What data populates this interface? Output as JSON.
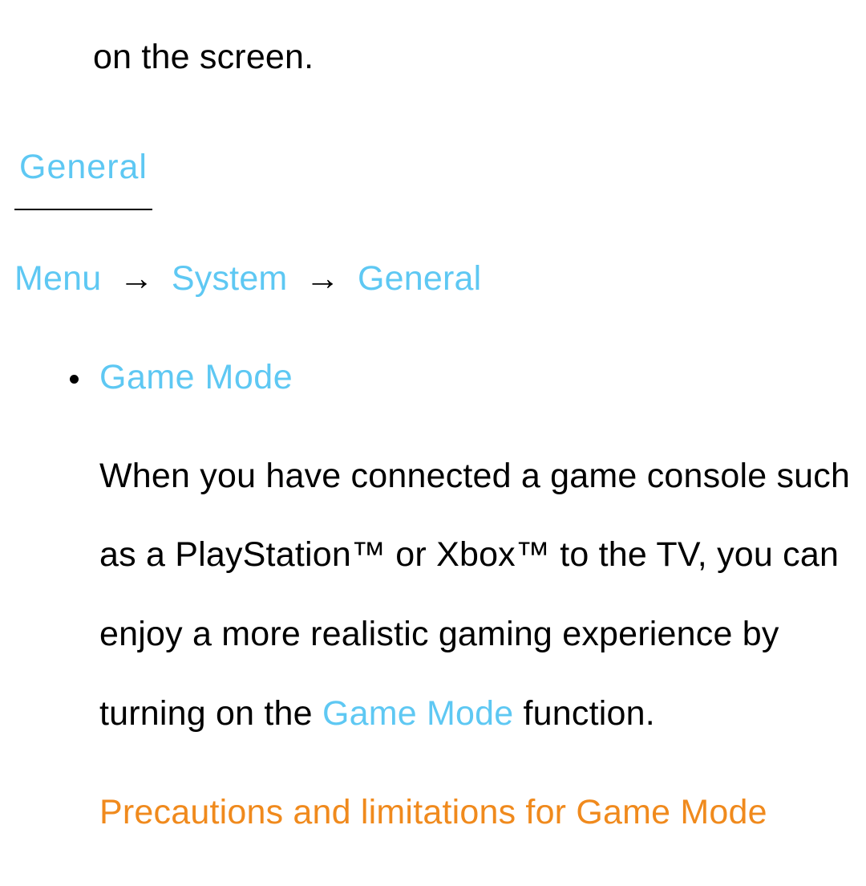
{
  "topline": "on the screen.",
  "heading": "General",
  "breadcrumb": {
    "menu": "Menu",
    "arrow1": "→",
    "system": "System",
    "arrow2": "→",
    "general": "General"
  },
  "item": {
    "title": "Game Mode",
    "desc_pre": "When you have connected a game console such as a PlayStation™ or Xbox™ to the TV, you can enjoy a more realistic gaming experience by turning on the ",
    "desc_hl": "Game Mode",
    "desc_post": " function.",
    "warn": "Precautions and limitations for Game Mode"
  }
}
